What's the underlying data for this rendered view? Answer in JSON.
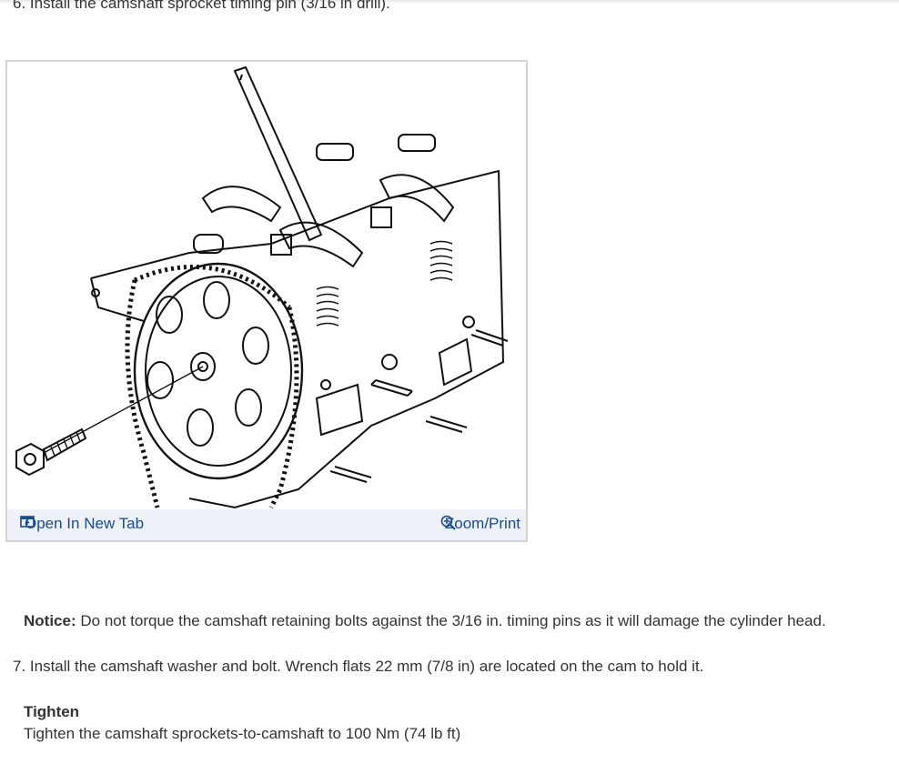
{
  "steps": {
    "step6": "6. Install the camshaft sprocket timing pin (3/16 in drill).",
    "step7": "7. Install the camshaft washer and bolt. Wrench flats 22 mm (7/8 in) are located on the cam to hold it."
  },
  "figure": {
    "open_new_tab_label": "Open In New Tab",
    "zoom_print_label": "Zoom/Print",
    "open_icon": "open-new-tab-icon",
    "zoom_icon": "zoom-plus-icon",
    "link_color": "#1a4b8c"
  },
  "notice": {
    "label": "Notice:",
    "text": "Do not torque the camshaft retaining bolts against the 3/16 in. timing pins as it will damage the cylinder head."
  },
  "tighten": {
    "title": "Tighten",
    "text": "Tighten the camshaft sprockets-to-camshaft to 100 Nm (74 lb ft)"
  }
}
